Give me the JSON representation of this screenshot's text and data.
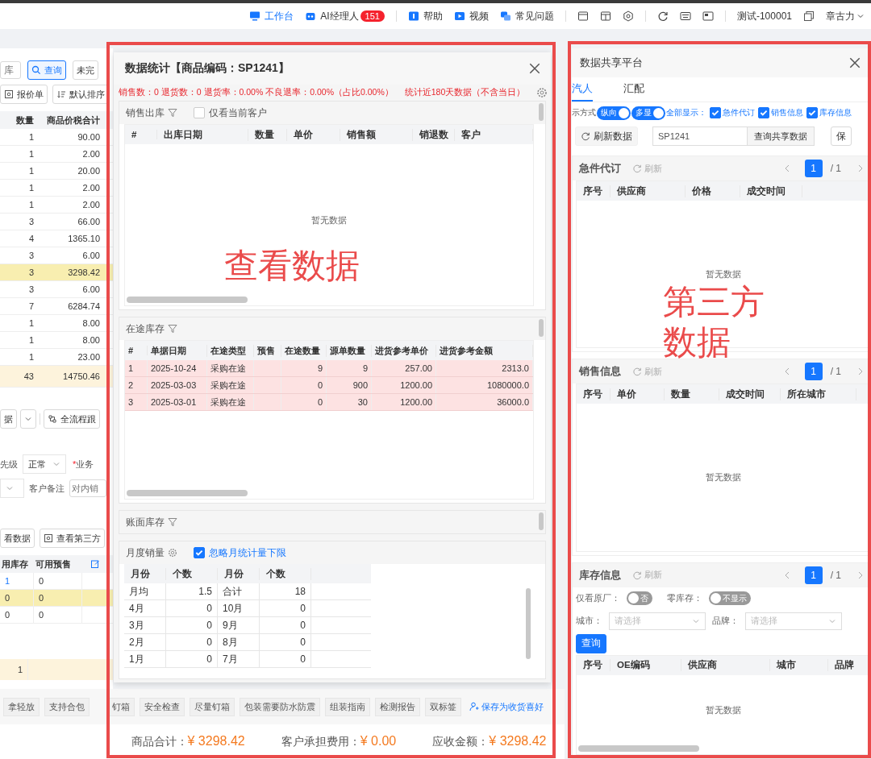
{
  "top_bar": {
    "workbench": "工作台",
    "ai_manager": "AI经理人",
    "ai_badge": "151",
    "help": "帮助",
    "video": "视频",
    "faq": "常见问题",
    "account": "测试-100001",
    "user": "章古力"
  },
  "order_page": {
    "search_placeholder": "库",
    "query_button": "查询",
    "unfinished_button": "未完",
    "quote_button": "报价单",
    "sort_dropdown": "默认排序",
    "items_table": {
      "columns": [
        "数量",
        "商品价税合计"
      ],
      "rows": [
        {
          "cells": [
            "1",
            "90.00"
          ],
          "selected": false
        },
        {
          "cells": [
            "1",
            "2.00"
          ],
          "selected": false
        },
        {
          "cells": [
            "1",
            "20.00"
          ],
          "selected": false
        },
        {
          "cells": [
            "1",
            "2.00"
          ],
          "selected": false
        },
        {
          "cells": [
            "1",
            "2.00"
          ],
          "selected": false
        },
        {
          "cells": [
            "3",
            "66.00"
          ],
          "selected": false
        },
        {
          "cells": [
            "4",
            "1365.10"
          ],
          "selected": false
        },
        {
          "cells": [
            "3",
            "6.00"
          ],
          "selected": false
        },
        {
          "cells": [
            "3",
            "3298.42"
          ],
          "selected": true
        },
        {
          "cells": [
            "3",
            "6.00"
          ],
          "selected": false
        },
        {
          "cells": [
            "7",
            "6284.74"
          ],
          "selected": false
        },
        {
          "cells": [
            "1",
            "8.00"
          ],
          "selected": false
        },
        {
          "cells": [
            "1",
            "8.00"
          ],
          "selected": false
        },
        {
          "cells": [
            "1",
            "23.00"
          ],
          "selected": false
        }
      ],
      "total": [
        "43",
        "14750.46"
      ]
    },
    "data_button": "据",
    "trace_button": "全流程跟",
    "priority_label": "先级",
    "priority_select": "正常",
    "required_mark": "*",
    "salesperson_label": "业务",
    "remark_label": "客户备注",
    "remark_placeholder": "对内销",
    "view_data_button": "看数据",
    "view_third_party_button": "查看第三方",
    "stock_table": {
      "columns": [
        "用库存",
        "可用预售"
      ],
      "rows": [
        {
          "cells": [
            "1",
            "0"
          ],
          "selected": false
        },
        {
          "cells": [
            "0",
            "0"
          ],
          "selected": true
        },
        {
          "cells": [
            "0",
            "0"
          ],
          "selected": false
        }
      ],
      "total": "1"
    },
    "tags": [
      "拿轻放",
      "支持合包",
      "钉箱",
      "安全检查",
      "尽量钉箱",
      "包装需要防水防震",
      "组装指南",
      "检测报告",
      "双标签"
    ],
    "save_preference_link": "保存为收货喜好",
    "footer": [
      {
        "label": "商品合计：",
        "amount": "¥ 3298.42"
      },
      {
        "label": "客户承担费用：",
        "amount": "¥ 0.00"
      },
      {
        "label": "应收金额：",
        "amount": "¥ 3298.42"
      }
    ]
  },
  "stats_dialog": {
    "title": "数据统计【商品编码：SP1241】",
    "summary": "销售数：0 退货数：0 退货率：0.00% 不良退率：0.00%（占比0.00%）",
    "period_note": "统计近180天数据（不含当日）",
    "sales_out": {
      "title": "销售出库",
      "only_current_customer": {
        "label": "仅看当前客户",
        "checked": false
      },
      "columns": [
        "#",
        "出库日期",
        "数量",
        "单价",
        "销售额",
        "销退数",
        "客户"
      ],
      "empty_text": "暂无数据"
    },
    "in_transit": {
      "title": "在途库存",
      "columns": [
        "#",
        "单据日期",
        "在途类型",
        "预售",
        "在途数量",
        "源单数量",
        "进货参考单价",
        "进货参考金额"
      ],
      "rows": [
        {
          "cells": [
            "1",
            "2025-10-24",
            "采购在途",
            "",
            "9",
            "9",
            "257.00",
            "2313.0"
          ]
        },
        {
          "cells": [
            "2",
            "2025-03-03",
            "采购在途",
            "",
            "0",
            "900",
            "1200.00",
            "1080000.0"
          ]
        },
        {
          "cells": [
            "3",
            "2025-03-01",
            "采购在途",
            "",
            "0",
            "30",
            "1200.00",
            "36000.0"
          ]
        }
      ]
    },
    "book_stock": {
      "title": "账面库存"
    },
    "monthly_sales": {
      "title": "月度销量",
      "ignore_lower_limit": {
        "label": "忽略月统计量下限",
        "checked": true
      },
      "columns": [
        "月份",
        "个数",
        "月份",
        "个数"
      ],
      "rows": [
        [
          "月均",
          "1.5",
          "合计",
          "18"
        ],
        [
          "4月",
          "0",
          "10月",
          "0"
        ],
        [
          "3月",
          "0",
          "9月",
          "0"
        ],
        [
          "2月",
          "0",
          "8月",
          "0"
        ],
        [
          "1月",
          "0",
          "7月",
          "0"
        ]
      ]
    }
  },
  "share_platform": {
    "title": "数据共享平台",
    "tabs": [
      {
        "label": "汽人",
        "selected": true
      },
      {
        "label": "汇配",
        "selected": false
      }
    ],
    "display_label": "示方式",
    "display_toggles": [
      {
        "label": "纵向",
        "on": true
      },
      {
        "label": "多显",
        "on": true
      }
    ],
    "show_all_label": "全部显示：",
    "show_checks": [
      {
        "label": "急件代订",
        "checked": true
      },
      {
        "label": "销售信息",
        "checked": true
      },
      {
        "label": "库存信息",
        "checked": true
      }
    ],
    "refresh_button": "刷新数据",
    "code_field": "SP1241",
    "query_button": "查询共享数据",
    "save_button": "保",
    "sections": [
      {
        "kind": "table",
        "title": "急件代订",
        "refresh": "刷新",
        "page": "1",
        "total_pages": "/ 1",
        "columns": [
          "序号",
          "供应商",
          "价格",
          "成交时间"
        ],
        "empty_text": "暂无数据"
      },
      {
        "kind": "table",
        "title": "销售信息",
        "refresh": "刷新",
        "page": "1",
        "total_pages": "/ 1",
        "columns": [
          "序号",
          "单价",
          "数量",
          "成交时间",
          "所在城市"
        ],
        "empty_text": "暂无数据"
      },
      {
        "kind": "stock",
        "title": "库存信息",
        "refresh": "刷新",
        "page": "1",
        "total_pages": "/ 1",
        "columns": [
          "序号",
          "OE编码",
          "供应商",
          "城市",
          "品牌"
        ],
        "empty_text": "暂无数据",
        "filters": {
          "oem_only": {
            "label": "仅看原厂：",
            "toggle": "否",
            "on": false
          },
          "zero_stock": {
            "label": "零库存：",
            "toggle": "不显示",
            "on": false
          },
          "city": {
            "label": "城市：",
            "placeholder": "请选择"
          },
          "brand": {
            "label": "品牌：",
            "placeholder": "请选择"
          },
          "query_button": "查询"
        }
      }
    ]
  },
  "annotations": [
    {
      "text": "查看数据"
    },
    {
      "text": "第三方数据"
    }
  ]
}
